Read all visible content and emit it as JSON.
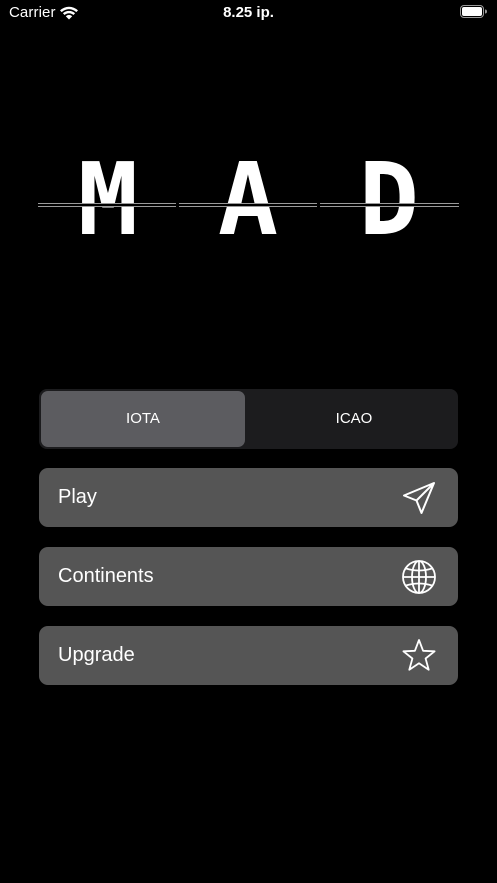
{
  "status_bar": {
    "carrier": "Carrier",
    "time": "8.25 ip."
  },
  "logo": {
    "letters": [
      "M",
      "A",
      "D"
    ]
  },
  "segment": {
    "options": [
      "IOTA",
      "ICAO"
    ],
    "selected": "IOTA"
  },
  "menu": {
    "play": {
      "label": "Play",
      "icon": "paper-plane-icon"
    },
    "continents": {
      "label": "Continents",
      "icon": "globe-icon"
    },
    "upgrade": {
      "label": "Upgrade",
      "icon": "star-icon"
    }
  },
  "colors": {
    "background": "#000000",
    "segment_bg": "#1c1c1e",
    "segment_selected": "#5c5c60",
    "button_bg": "#555555",
    "text": "#ffffff"
  }
}
